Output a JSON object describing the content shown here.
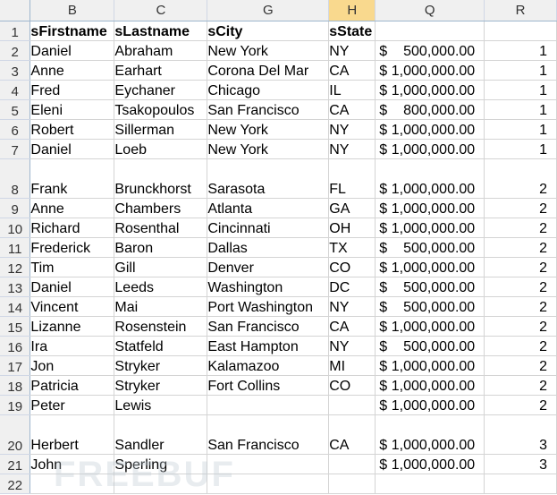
{
  "columns": [
    {
      "id": "row-header",
      "label": ""
    },
    {
      "id": "B",
      "label": "B"
    },
    {
      "id": "C",
      "label": "C"
    },
    {
      "id": "G",
      "label": "G"
    },
    {
      "id": "H",
      "label": "H"
    },
    {
      "id": "Q",
      "label": "Q"
    },
    {
      "id": "R",
      "label": "R"
    }
  ],
  "rows": [
    {
      "num": "1",
      "first": "sFirstname",
      "last": "sLastname",
      "city": "sCity",
      "state": "sState",
      "sym": "",
      "amount": "",
      "group": ""
    },
    {
      "num": "2",
      "first": "Daniel",
      "last": "Abraham",
      "city": "New York",
      "state": "NY",
      "sym": "$",
      "amount": "500,000.00",
      "group": "1"
    },
    {
      "num": "3",
      "first": "Anne",
      "last": "Earhart",
      "city": "Corona Del Mar",
      "state": "CA",
      "sym": "$",
      "amount": "1,000,000.00",
      "group": "1"
    },
    {
      "num": "4",
      "first": "Fred",
      "last": "Eychaner",
      "city": "Chicago",
      "state": "IL",
      "sym": "$",
      "amount": "1,000,000.00",
      "group": "1"
    },
    {
      "num": "5",
      "first": "Eleni",
      "last": "Tsakopoulos",
      "city": "San Francisco",
      "state": "CA",
      "sym": "$",
      "amount": "800,000.00",
      "group": "1"
    },
    {
      "num": "6",
      "first": "Robert",
      "last": "Sillerman",
      "city": "New York",
      "state": "NY",
      "sym": "$",
      "amount": "1,000,000.00",
      "group": "1"
    },
    {
      "num": "7",
      "first": "Daniel",
      "last": "Loeb",
      "city": "New York",
      "state": "NY",
      "sym": "$",
      "amount": "1,000,000.00",
      "group": "1"
    },
    {
      "num": "8",
      "first": "Frank",
      "last": "Brunckhorst",
      "city": "Sarasota",
      "state": "FL",
      "sym": "$",
      "amount": "1,000,000.00",
      "group": "2"
    },
    {
      "num": "9",
      "first": "Anne",
      "last": "Chambers",
      "city": "Atlanta",
      "state": "GA",
      "sym": "$",
      "amount": "1,000,000.00",
      "group": "2"
    },
    {
      "num": "10",
      "first": "Richard",
      "last": "Rosenthal",
      "city": "Cincinnati",
      "state": "OH",
      "sym": "$",
      "amount": "1,000,000.00",
      "group": "2"
    },
    {
      "num": "11",
      "first": "Frederick",
      "last": "Baron",
      "city": "Dallas",
      "state": "TX",
      "sym": "$",
      "amount": "500,000.00",
      "group": "2"
    },
    {
      "num": "12",
      "first": "Tim",
      "last": "Gill",
      "city": "Denver",
      "state": "CO",
      "sym": "$",
      "amount": "1,000,000.00",
      "group": "2"
    },
    {
      "num": "13",
      "first": "Daniel",
      "last": "Leeds",
      "city": "Washington",
      "state": "DC",
      "sym": "$",
      "amount": "500,000.00",
      "group": "2"
    },
    {
      "num": "14",
      "first": "Vincent",
      "last": "Mai",
      "city": "Port Washington",
      "state": "NY",
      "sym": "$",
      "amount": "500,000.00",
      "group": "2"
    },
    {
      "num": "15",
      "first": "Lizanne",
      "last": "Rosenstein",
      "city": "San Francisco",
      "state": "CA",
      "sym": "$",
      "amount": "1,000,000.00",
      "group": "2"
    },
    {
      "num": "16",
      "first": "Ira",
      "last": "Statfeld",
      "city": "East Hampton",
      "state": "NY",
      "sym": "$",
      "amount": "500,000.00",
      "group": "2"
    },
    {
      "num": "17",
      "first": "Jon",
      "last": "Stryker",
      "city": "Kalamazoo",
      "state": "MI",
      "sym": "$",
      "amount": "1,000,000.00",
      "group": "2"
    },
    {
      "num": "18",
      "first": "Patricia",
      "last": "Stryker",
      "city": "Fort Collins",
      "state": "CO",
      "sym": "$",
      "amount": "1,000,000.00",
      "group": "2"
    },
    {
      "num": "19",
      "first": "Peter",
      "last": "Lewis",
      "city": "",
      "state": "",
      "sym": "$",
      "amount": "1,000,000.00",
      "group": "2"
    },
    {
      "num": "20",
      "first": "Herbert",
      "last": "Sandler",
      "city": "San Francisco",
      "state": "CA",
      "sym": "$",
      "amount": "1,000,000.00",
      "group": "3"
    },
    {
      "num": "21",
      "first": "John",
      "last": "Sperling",
      "city": "",
      "state": "",
      "sym": "$",
      "amount": "1,000,000.00",
      "group": "3"
    },
    {
      "num": "22",
      "first": "",
      "last": "",
      "city": "",
      "state": "",
      "sym": "",
      "amount": "",
      "group": ""
    }
  ],
  "watermark": "FREEBUF"
}
